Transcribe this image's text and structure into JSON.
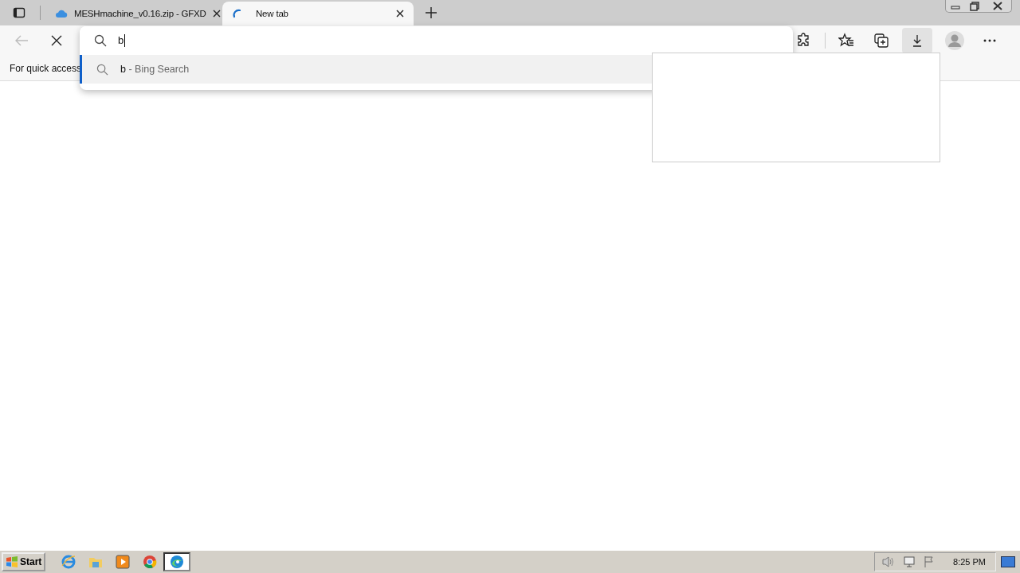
{
  "tabs": [
    {
      "title": "MESHmachine_v0.16.zip - GFXD",
      "selected": false,
      "loading": false
    },
    {
      "title": "New tab",
      "selected": true,
      "loading": true
    }
  ],
  "address_bar": {
    "value": "b"
  },
  "suggestions": [
    {
      "query": "b",
      "source": " - Bing Search",
      "selected": true
    }
  ],
  "bookmarks_bar": {
    "text": "For quick access"
  },
  "downloads_button": {
    "selected": true
  },
  "taskbar": {
    "start": "Start",
    "apps": [
      {
        "kind": "ie",
        "selected": false
      },
      {
        "kind": "folder",
        "selected": false
      },
      {
        "kind": "media",
        "selected": false
      },
      {
        "kind": "chrome",
        "selected": false
      },
      {
        "kind": "edge",
        "selected": true
      }
    ],
    "clock": "8:25 PM"
  }
}
